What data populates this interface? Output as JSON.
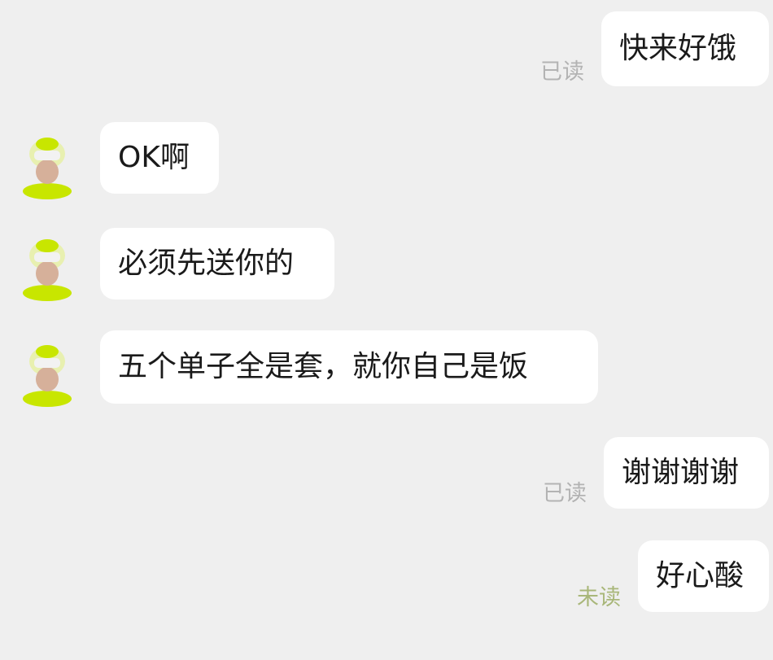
{
  "messages": [
    {
      "side": "right",
      "text": "快来好饿",
      "status": "已读"
    },
    {
      "side": "left",
      "text": "OK啊"
    },
    {
      "side": "left",
      "text": "必须先送你的"
    },
    {
      "side": "left",
      "text": "五个单子全是套，就你自己是饭"
    },
    {
      "side": "right",
      "text": "谢谢谢谢",
      "status": "已读"
    },
    {
      "side": "right",
      "text": "好心酸",
      "status": "未读"
    }
  ],
  "colors": {
    "background": "#efefef",
    "bubble": "#ffffff",
    "read_status": "#b3b3b3",
    "unread_status": "#a9b77a",
    "avatar_accent": "#c8e600"
  },
  "icons": {
    "avatar": "avatar-icon"
  }
}
